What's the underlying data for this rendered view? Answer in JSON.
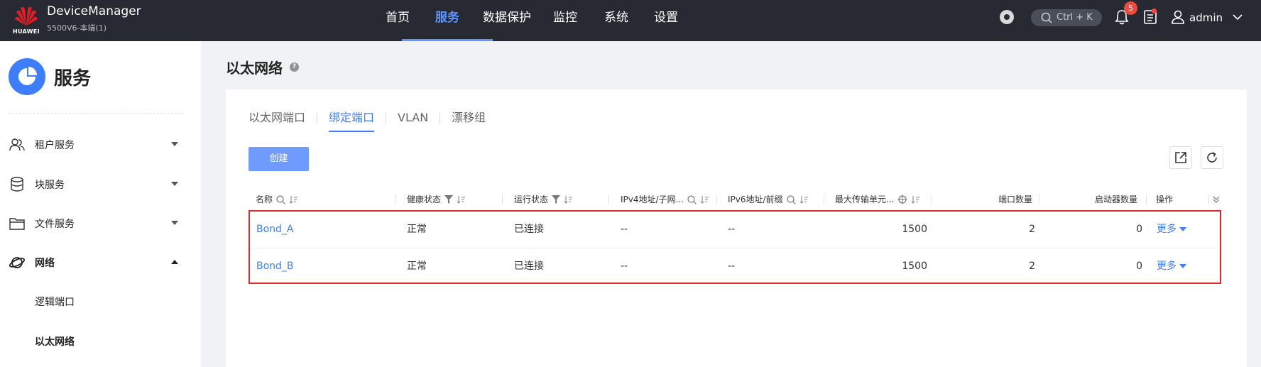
{
  "brand": {
    "title": "DeviceManager",
    "subtitle": "5500V6-本端(1)",
    "logo_text": "HUAWEI"
  },
  "nav": {
    "items": [
      {
        "label": "首页",
        "active": false
      },
      {
        "label": "服务",
        "active": true
      },
      {
        "label": "数据保护",
        "active": false
      },
      {
        "label": "监控",
        "active": false
      },
      {
        "label": "系统",
        "active": false
      },
      {
        "label": "设置",
        "active": false
      }
    ]
  },
  "topbar": {
    "search_label": "Ctrl + K",
    "notification_count": "5",
    "username": "admin"
  },
  "sidebar": {
    "title": "服务",
    "items": [
      {
        "label": "租户服务",
        "icon": "users-icon",
        "expanded": false
      },
      {
        "label": "块服务",
        "icon": "database-icon",
        "expanded": false
      },
      {
        "label": "文件服务",
        "icon": "folder-icon",
        "expanded": false
      },
      {
        "label": "网络",
        "icon": "planet-icon",
        "expanded": true
      }
    ],
    "subitems": [
      {
        "label": "逻辑端口",
        "active": false
      },
      {
        "label": "以太网络",
        "active": true
      }
    ]
  },
  "page": {
    "title": "以太网络"
  },
  "tabs": [
    {
      "label": "以太网端口",
      "active": false
    },
    {
      "label": "绑定端口",
      "active": true
    },
    {
      "label": "VLAN",
      "active": false
    },
    {
      "label": "漂移组",
      "active": false
    }
  ],
  "toolbar": {
    "create_label": "创建"
  },
  "table": {
    "columns": [
      "名称",
      "健康状态",
      "运行状态",
      "IPv4地址/子网...",
      "IPv6地址/前缀",
      "最大传输单元...",
      "端口数量",
      "启动器数量",
      "操作"
    ],
    "rows": [
      {
        "name": "Bond_A",
        "health": "正常",
        "running": "已连接",
        "ipv4": "--",
        "ipv6": "--",
        "mtu": "1500",
        "ports": "2",
        "initiators": "0",
        "action": "更多"
      },
      {
        "name": "Bond_B",
        "health": "正常",
        "running": "已连接",
        "ipv4": "--",
        "ipv6": "--",
        "mtu": "1500",
        "ports": "2",
        "initiators": "0",
        "action": "更多"
      }
    ]
  },
  "colors": {
    "accent": "#3d7eff",
    "topbar": "#272a33",
    "highlight_border": "#e0282a"
  }
}
